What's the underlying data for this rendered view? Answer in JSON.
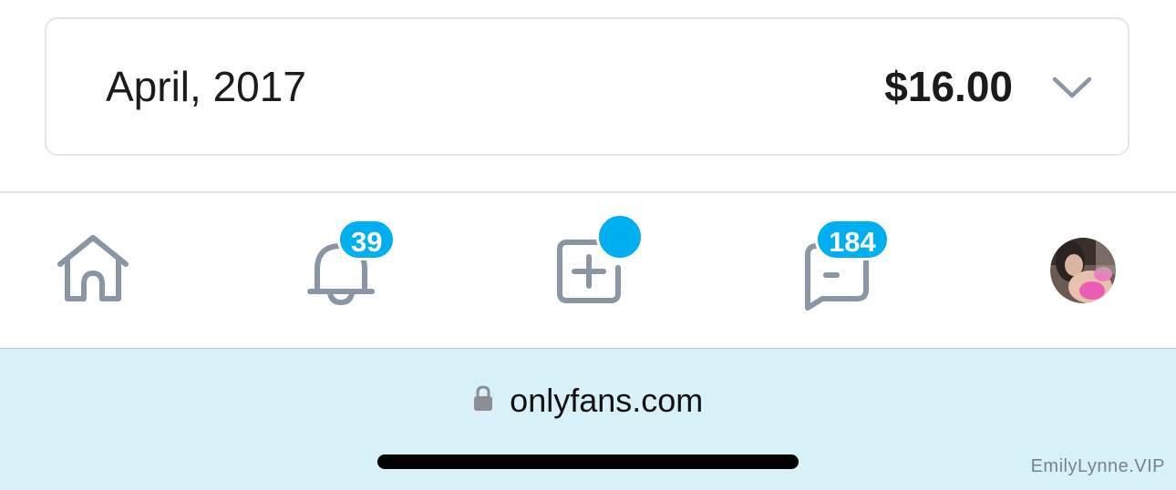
{
  "earnings_row": {
    "month": "April, 2017",
    "amount": "$16.00",
    "expand_icon": "chevron-down-icon"
  },
  "bottom_nav": {
    "home": {
      "icon": "home-icon"
    },
    "notifications": {
      "icon": "bell-icon",
      "badge": "39"
    },
    "new_post": {
      "icon": "add-square-icon",
      "has_dot": true
    },
    "messages": {
      "icon": "chat-icon",
      "badge": "184"
    },
    "profile": {
      "icon": "avatar"
    }
  },
  "browser": {
    "lock_icon": "lock-icon",
    "url": "onlyfans.com"
  },
  "watermark": "EmilyLynne.VIP",
  "colors": {
    "accent": "#00aff0",
    "icon_gray": "#8a96a3",
    "browser_bar": "#d8f0f8",
    "text": "#1b1b1b"
  }
}
